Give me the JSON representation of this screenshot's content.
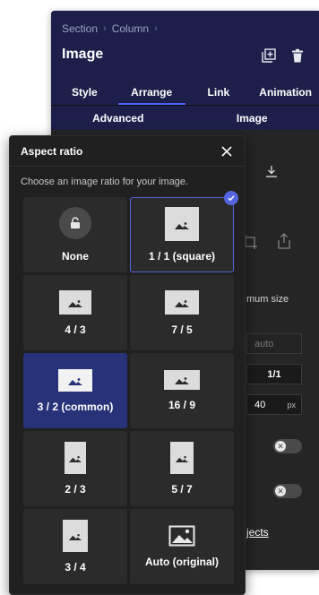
{
  "panel": {
    "breadcrumb": [
      "Section",
      "Column"
    ],
    "title": "Image",
    "tabs": [
      "Style",
      "Arrange",
      "Link",
      "Animation"
    ],
    "active_tab": "Arrange",
    "subtabs": [
      "Advanced",
      "Image"
    ],
    "min_size_label": "mum size",
    "auto_value": "auto",
    "ratio_value": "1/1",
    "number_value": "40",
    "number_unit": "px",
    "objects_link": "jects"
  },
  "popup": {
    "title": "Aspect ratio",
    "description": "Choose an image ratio for your image.",
    "options": [
      {
        "label": "None",
        "kind": "lock"
      },
      {
        "label": "1 / 1 (square)",
        "kind": "thumb",
        "state": "selected"
      },
      {
        "label": "4 / 3",
        "kind": "thumb"
      },
      {
        "label": "7 / 5",
        "kind": "thumb"
      },
      {
        "label": "3 / 2 (common)",
        "kind": "thumb",
        "state": "highlighted"
      },
      {
        "label": "16 / 9",
        "kind": "thumb"
      },
      {
        "label": "2 / 3",
        "kind": "thumb"
      },
      {
        "label": "5 / 7",
        "kind": "thumb"
      },
      {
        "label": "3 / 4",
        "kind": "thumb"
      },
      {
        "label": "Auto (original)",
        "kind": "image-outline"
      }
    ]
  },
  "colors": {
    "panel_header": "#1d1f4a",
    "accent": "#5566e0",
    "highlight": "#283278",
    "cell_bg": "#2b2b2b"
  }
}
